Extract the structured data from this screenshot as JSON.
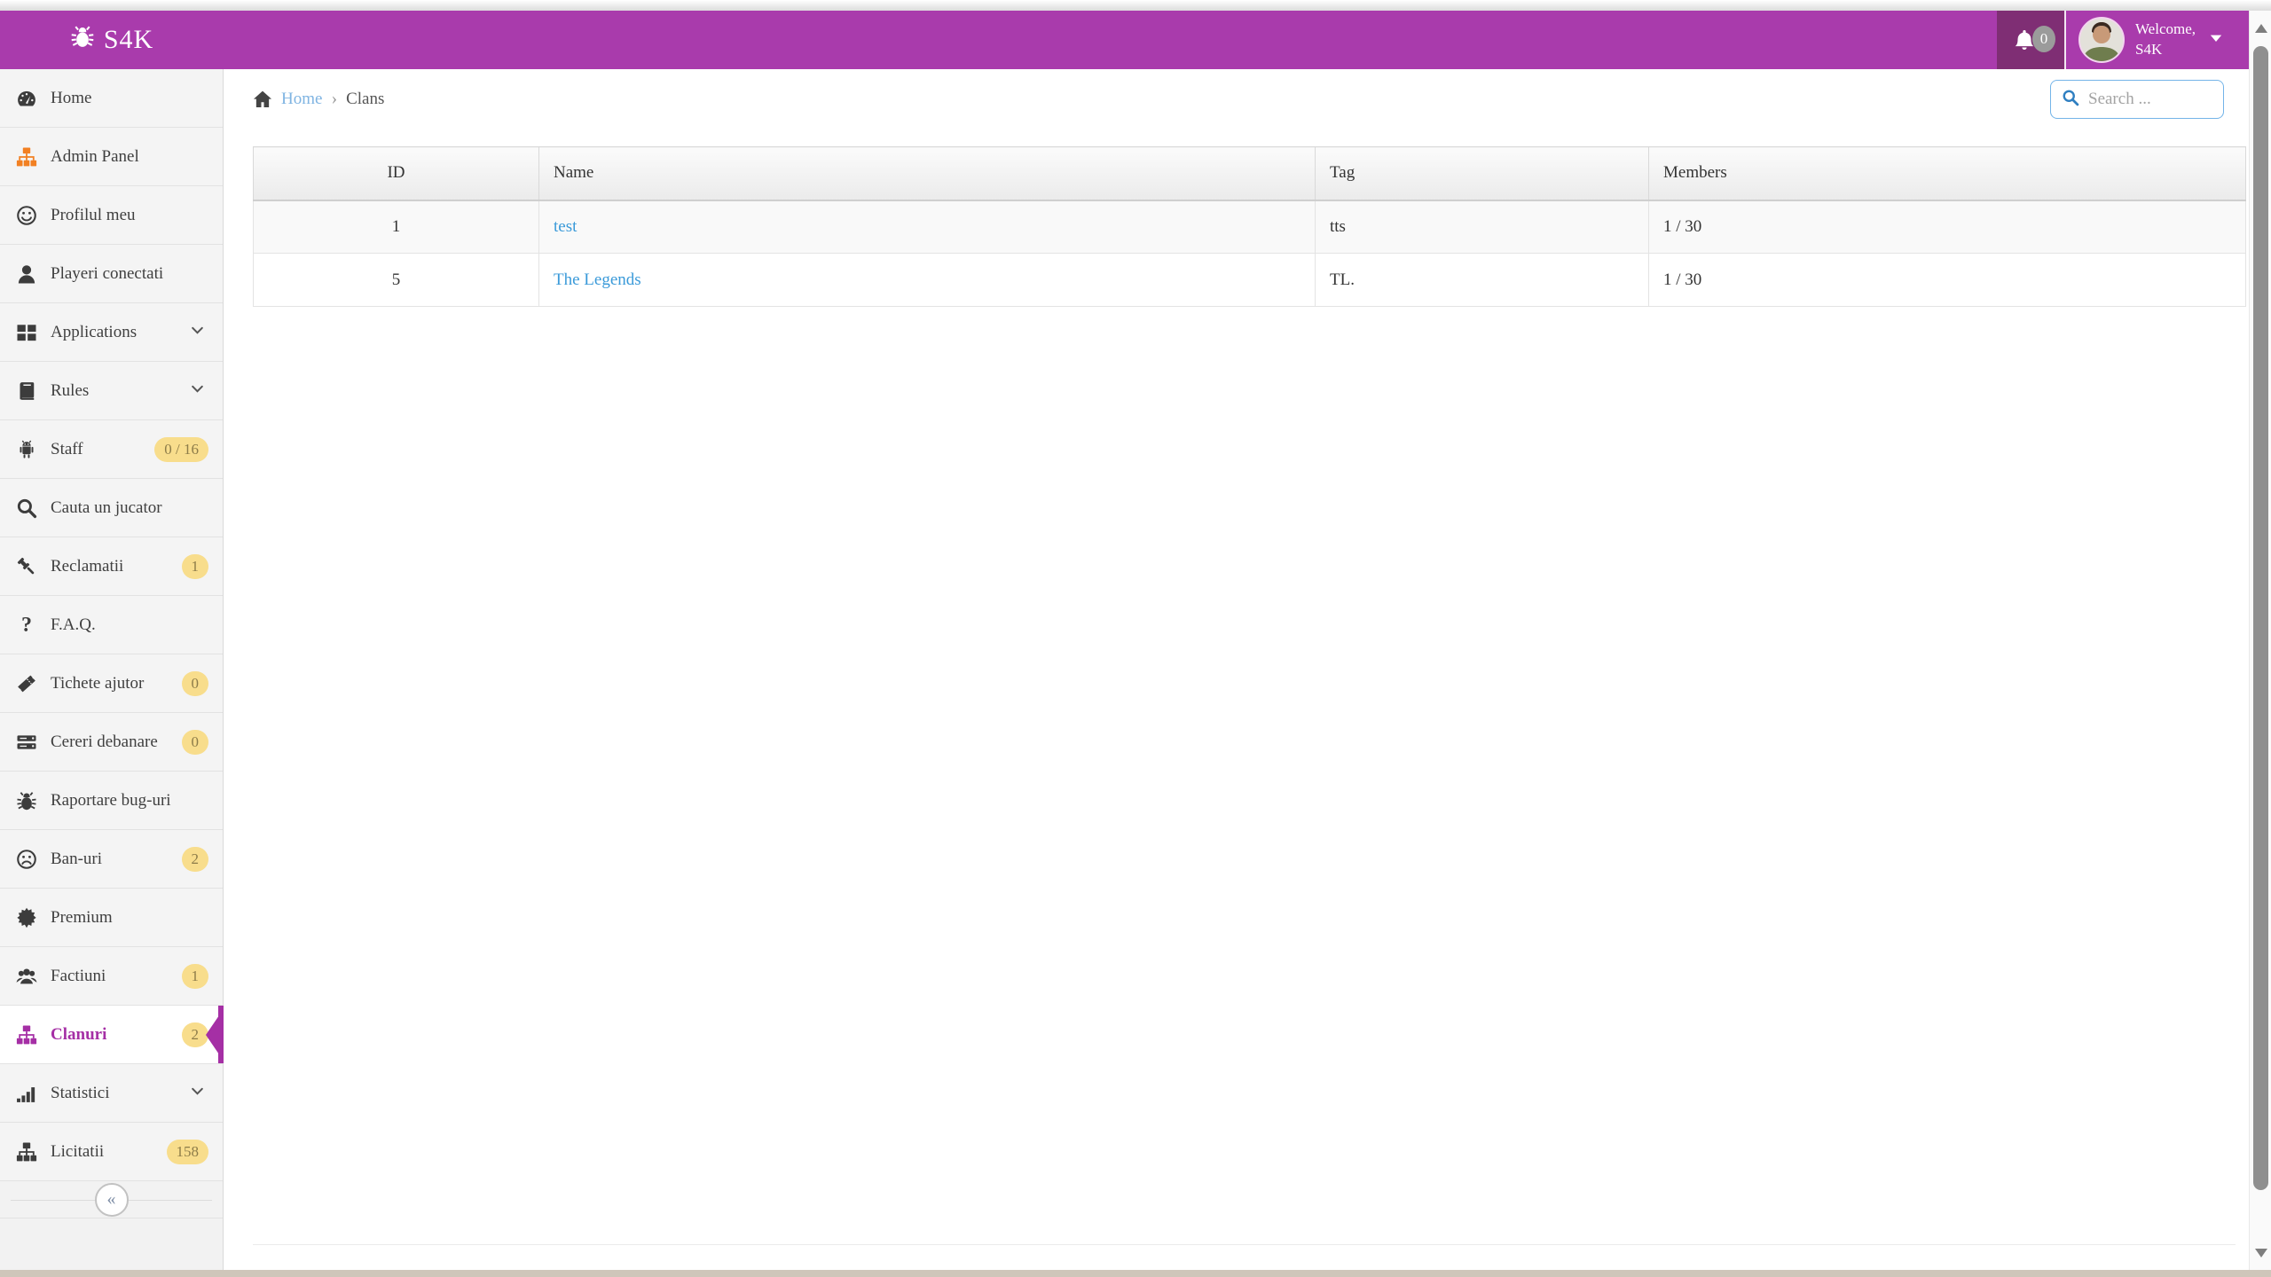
{
  "app": {
    "brand": "S4K",
    "accent_color": "#a93bac",
    "accent_dark_color": "#7f2e74",
    "active_color": "#a52fa5",
    "badge_bg_color": "#f8dd8c",
    "badge_text_color": "#8d7c49",
    "link_color": "#3a9ad9",
    "brand_icon": "bug-icon"
  },
  "header": {
    "notifications": {
      "icon": "bell-icon",
      "count": "0"
    },
    "user": {
      "avatar_icon": "avatar-photo",
      "welcome_line1": "Welcome,",
      "welcome_line2": "S4K",
      "caret_icon": "caret-down-icon"
    }
  },
  "sidebar": {
    "items": [
      {
        "icon": "dashboard-icon",
        "label": "Home"
      },
      {
        "icon": "sitemap-icon",
        "label": "Admin Panel",
        "icon_color": "#f28022"
      },
      {
        "icon": "smiley-icon",
        "label": "Profilul meu"
      },
      {
        "icon": "user-icon",
        "label": "Playeri conectati"
      },
      {
        "icon": "grid-icon",
        "label": "Applications",
        "chevron": true
      },
      {
        "icon": "book-icon",
        "label": "Rules",
        "chevron": true
      },
      {
        "icon": "android-icon",
        "label": "Staff",
        "badge": "0 / 16"
      },
      {
        "icon": "search-icon",
        "label": "Cauta un jucator"
      },
      {
        "icon": "gavel-icon",
        "label": "Reclamatii",
        "badge": "1"
      },
      {
        "icon": "question-icon",
        "label": "F.A.Q."
      },
      {
        "icon": "ticket-icon",
        "label": "Tichete ajutor",
        "badge": "0"
      },
      {
        "icon": "server-icon",
        "label": "Cereri debanare",
        "badge": "0"
      },
      {
        "icon": "bug-icon",
        "label": "Raportare bug-uri"
      },
      {
        "icon": "frown-icon",
        "label": "Ban-uri",
        "badge": "2"
      },
      {
        "icon": "seal-icon",
        "label": "Premium"
      },
      {
        "icon": "users-icon",
        "label": "Factiuni",
        "badge": "1"
      },
      {
        "icon": "sitemap-icon",
        "label": "Clanuri",
        "badge": "2",
        "active": true
      },
      {
        "icon": "signal-icon",
        "label": "Statistici",
        "chevron": true
      },
      {
        "icon": "sitemap-icon",
        "label": "Licitatii",
        "badge": "158"
      }
    ],
    "collapse_icon": "angle-double-left-icon",
    "collapse_glyph": "«"
  },
  "breadcrumb": {
    "home_icon": "home-icon",
    "home_label": "Home",
    "separator": "›",
    "current": "Clans"
  },
  "search": {
    "icon": "search-icon",
    "placeholder": "Search ...",
    "value": ""
  },
  "table": {
    "columns": [
      "ID",
      "Name",
      "Tag",
      "Members"
    ],
    "rows": [
      {
        "id": "1",
        "name": "test",
        "tag": "tts",
        "members": "1 / 30"
      },
      {
        "id": "5",
        "name": "The Legends",
        "tag": "TL.",
        "members": "1 / 30"
      }
    ]
  },
  "scrollbar": {
    "up_icon": "triangle-up-icon",
    "down_icon": "triangle-down-icon"
  }
}
